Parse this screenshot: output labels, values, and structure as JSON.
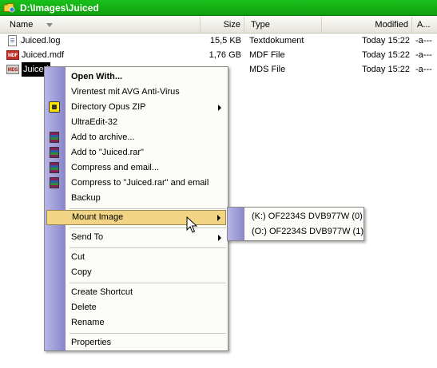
{
  "window": {
    "title": "D:\\Images\\Juiced"
  },
  "columns": {
    "name": "Name",
    "size": "Size",
    "type": "Type",
    "modified": "Modified",
    "attr": "A..."
  },
  "files": [
    {
      "name": "Juiced.log",
      "size": "15,5 KB",
      "type": "Textdokument",
      "modified": "Today 15:22",
      "attr": "-a---",
      "icon": "text-file-icon"
    },
    {
      "name": "Juiced.mdf",
      "size": "1,76 GB",
      "type": "MDF File",
      "modified": "Today 15:22",
      "attr": "-a---",
      "icon": "mdf-file-icon"
    },
    {
      "name": "Juiced",
      "size": "",
      "type": "MDS File",
      "modified": "Today 15:22",
      "attr": "-a---",
      "icon": "mds-file-icon"
    }
  ],
  "menu": {
    "open_with": "Open With...",
    "virentest": "Virentest mit AVG Anti-Virus",
    "opus_zip": "Directory Opus ZIP",
    "ultraedit": "UltraEdit-32",
    "add_archive": "Add to archive...",
    "add_rar": "Add to \"Juiced.rar\"",
    "compress_email": "Compress and email...",
    "compress_rar_email": "Compress to \"Juiced.rar\" and email",
    "backup": "Backup",
    "mount_image": "Mount Image",
    "send_to": "Send To",
    "cut": "Cut",
    "copy": "Copy",
    "create_shortcut": "Create Shortcut",
    "delete": "Delete",
    "rename": "Rename",
    "properties": "Properties"
  },
  "submenu": {
    "drive_k": "(K:) OF2234S DVB977W (0)",
    "drive_o": "(O:) OF2234S DVB977W (1)"
  },
  "colors": {
    "title_bar": "#12b014",
    "menu_highlight": "#f1d584",
    "menu_strip": "#9f9cd8"
  }
}
